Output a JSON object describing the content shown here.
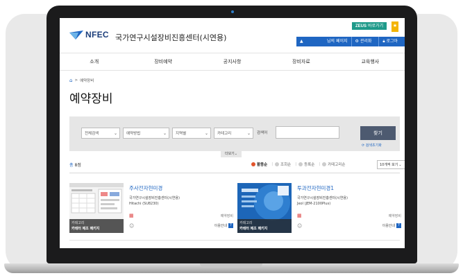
{
  "header": {
    "logo_text": "NFEC",
    "site_title": "국가연구시설장비진흥센터(시연용)",
    "zeus_brand": "ZEUS",
    "zeus_label": "바로가기",
    "user_name": "님의 페이지",
    "admin_label": "관리화면",
    "logout_label": "로그아웃"
  },
  "nav": {
    "items": [
      "소개",
      "장비예약",
      "공지사항",
      "장비자료",
      "교육행사"
    ]
  },
  "breadcrumb": {
    "current": "예약장비"
  },
  "page_title": "예약장비",
  "search": {
    "filters": [
      "전체검색",
      "예약방법",
      "지역별",
      "카테고리"
    ],
    "keyword_label": "검색어",
    "find_button": "찾기",
    "reset_label": "검색초기화",
    "more_label": "더보기"
  },
  "results": {
    "total_label": "총",
    "count": "8점",
    "sort_options": [
      "활용순",
      "조회순",
      "등록순",
      "카테고리순"
    ],
    "active_sort": "활용순",
    "per_page": "10개씩 보기"
  },
  "cards": [
    {
      "name": "주사전자현미경",
      "institution": "국가연구시설장비진흥센터(시연용)",
      "model": "Hitachi (SU8230)",
      "category_label": "카테고리",
      "category_value": "카테터 제조 패키지",
      "status": "예약장비",
      "guide_label": "이용안내"
    },
    {
      "name": "투과전자현미경1",
      "institution": "국가연구시설장비진흥센터(시연용)",
      "model": "Jeol (JEM-2100Plus)",
      "category_label": "카테고리",
      "category_value": "카테터 제조 패키지",
      "status": "예약장비",
      "guide_label": "이용안내"
    }
  ],
  "colors": {
    "accent": "#1f66c2",
    "zeus": "#1f9a8a",
    "star": "#f4b400",
    "button": "#4d5a70",
    "active_sort_dot": "#e2552d"
  }
}
